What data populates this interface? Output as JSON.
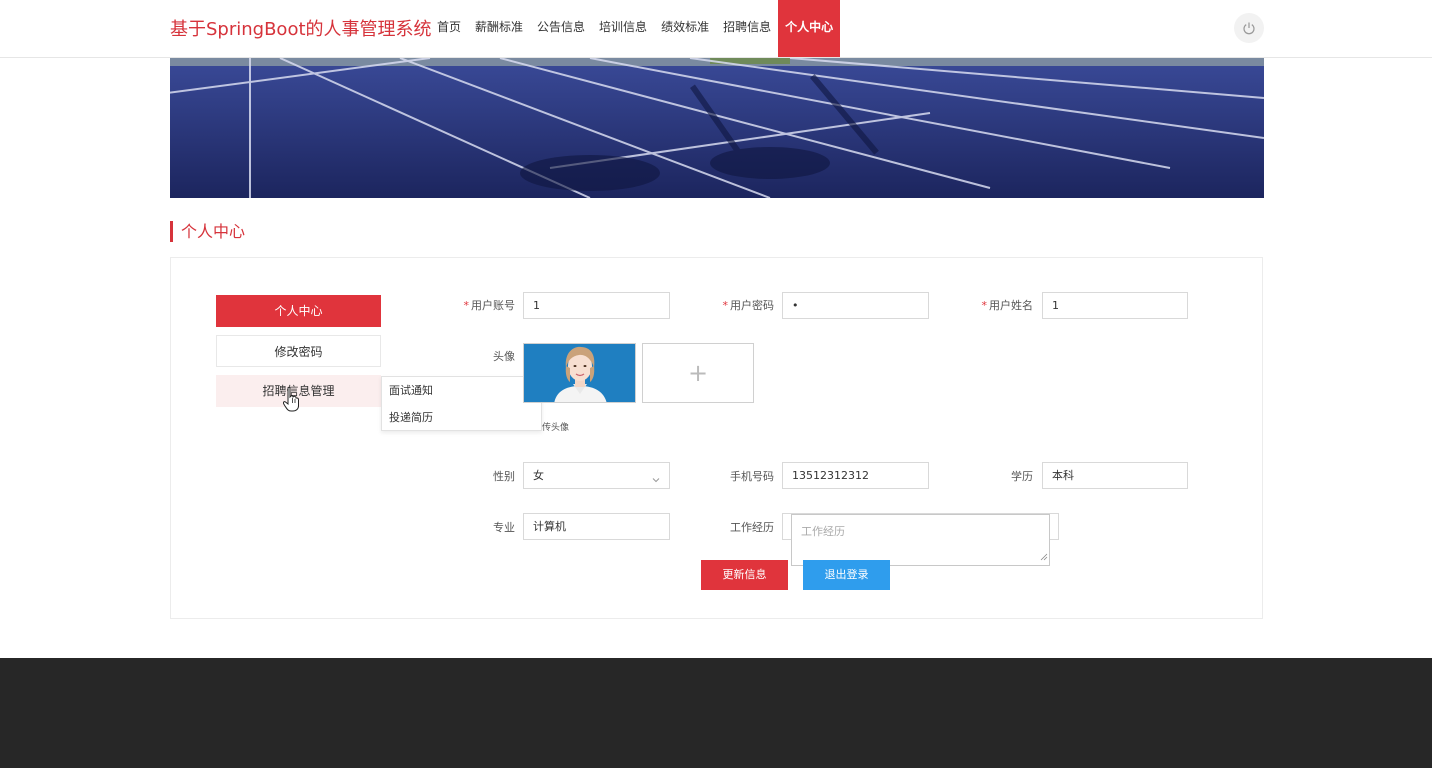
{
  "header": {
    "brand": "基于SpringBoot的人事管理系统",
    "nav": [
      "首页",
      "薪酬标准",
      "公告信息",
      "培训信息",
      "绩效标准",
      "招聘信息",
      "个人中心"
    ],
    "active_nav": "个人中心"
  },
  "section": {
    "title": "个人中心"
  },
  "side_menu": {
    "items": [
      "个人中心",
      "修改密码",
      "招聘信息管理"
    ],
    "submenu": [
      "面试通知",
      "投递简历"
    ]
  },
  "form": {
    "account_label": "用户账号",
    "account_value": "1",
    "password_label": "用户密码",
    "password_value": "•",
    "name_label": "用户姓名",
    "name_value": "1",
    "avatar_label": "头像",
    "upload_tip": "传头像",
    "gender_label": "性别",
    "gender_value": "女",
    "phone_label": "手机号码",
    "phone_value": "13512312312",
    "education_label": "学历",
    "education_value": "本科",
    "major_label": "专业",
    "major_value": "计算机",
    "experience_label": "工作经历",
    "experience_placeholder": "工作经历",
    "required_mark": "*"
  },
  "buttons": {
    "update": "更新信息",
    "logout": "退出登录"
  },
  "icons": {
    "power": "power-icon",
    "plus": "plus-icon",
    "cursor": "hand-cursor-icon",
    "chevron": "chevron-down-icon"
  },
  "colors": {
    "accent": "#e0343c",
    "blue": "#2f9ded",
    "footer": "#272727"
  }
}
